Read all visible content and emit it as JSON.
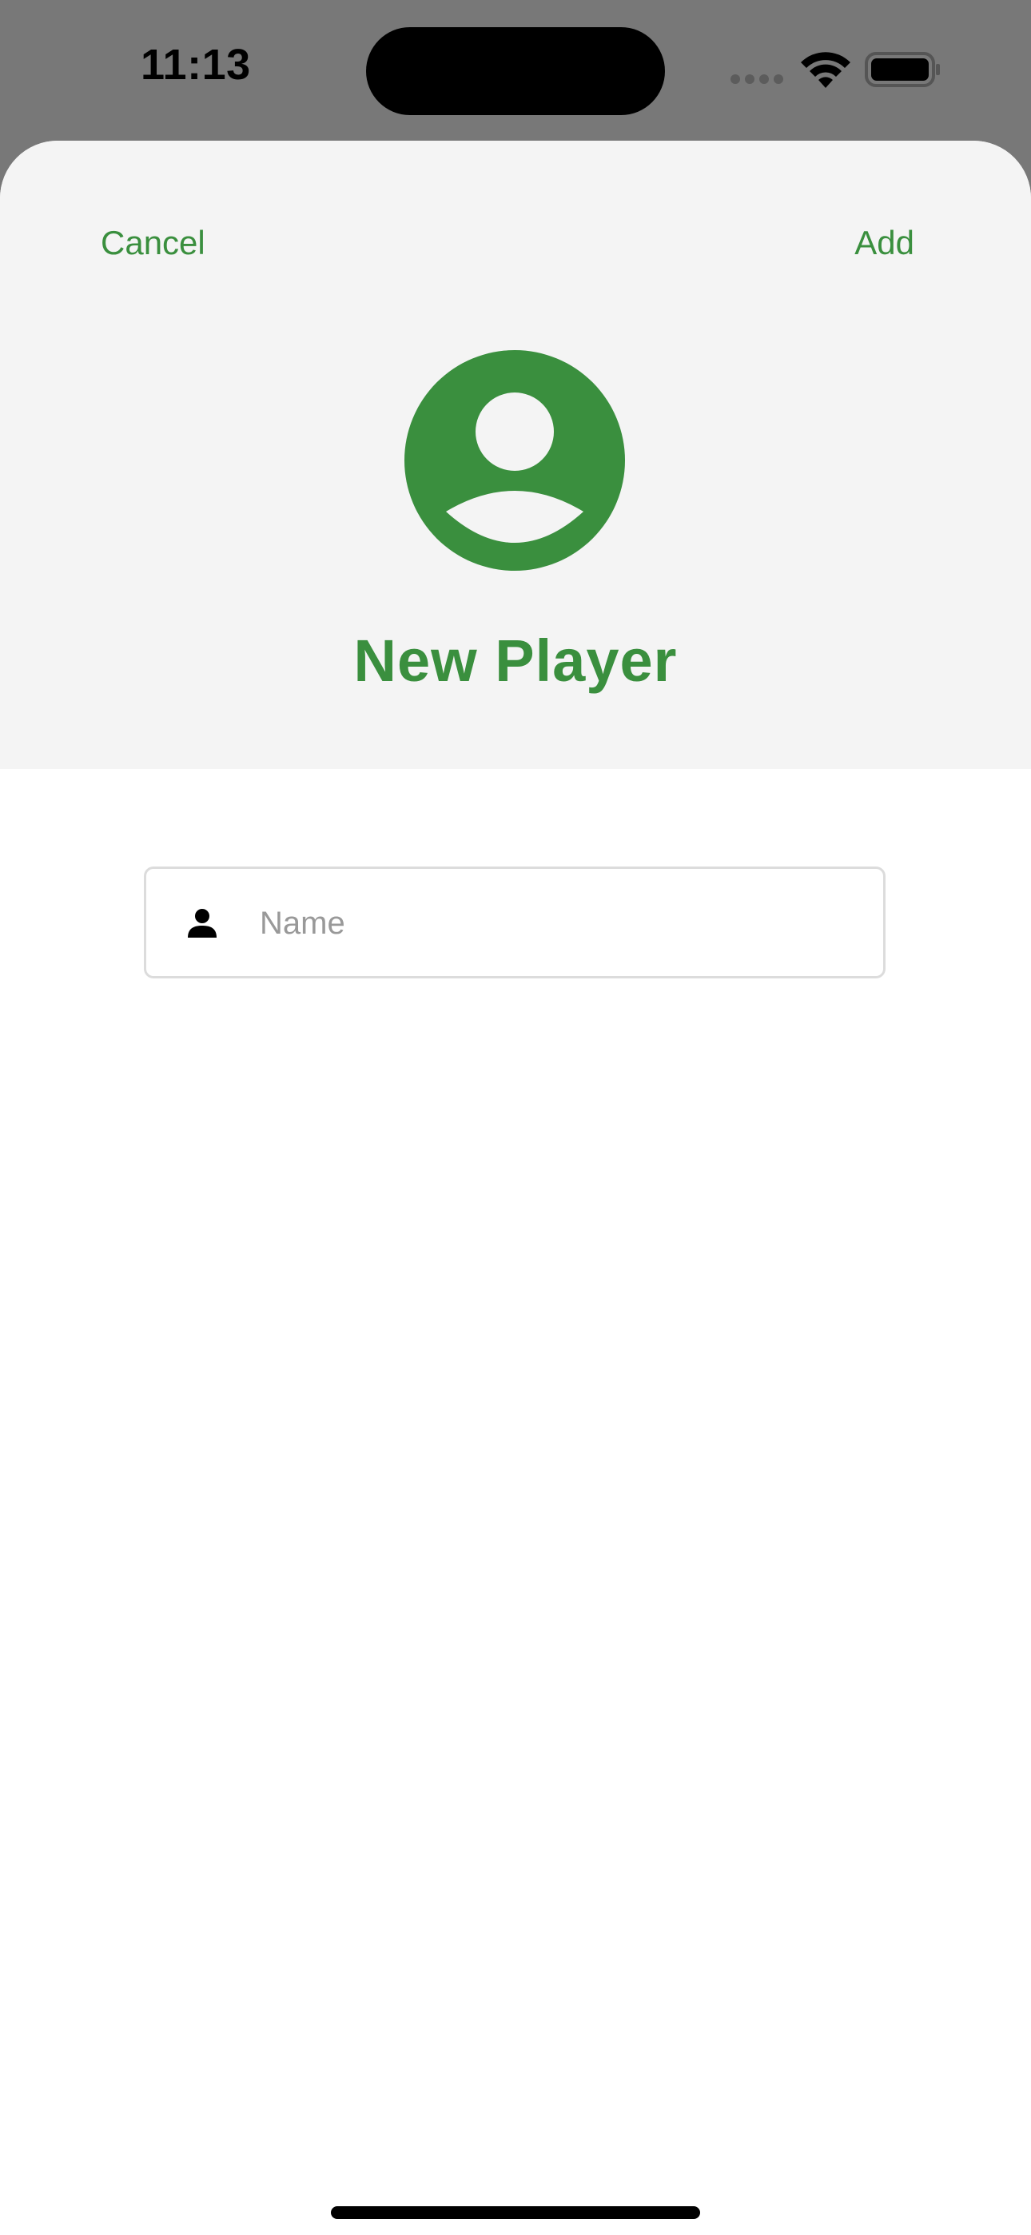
{
  "status_bar": {
    "time": "11:13",
    "icons": [
      "cellular-signal-icon",
      "wifi-icon",
      "battery-icon"
    ]
  },
  "header": {
    "cancel_label": "Cancel",
    "add_label": "Add",
    "avatar_icon": "person-circle-icon",
    "title": "New Player"
  },
  "form": {
    "name": {
      "icon": "person-icon",
      "placeholder": "Name",
      "value": ""
    }
  },
  "colors": {
    "accent": "#3a8f3e",
    "header_background": "#f4f4f4",
    "backdrop": "#787878"
  }
}
